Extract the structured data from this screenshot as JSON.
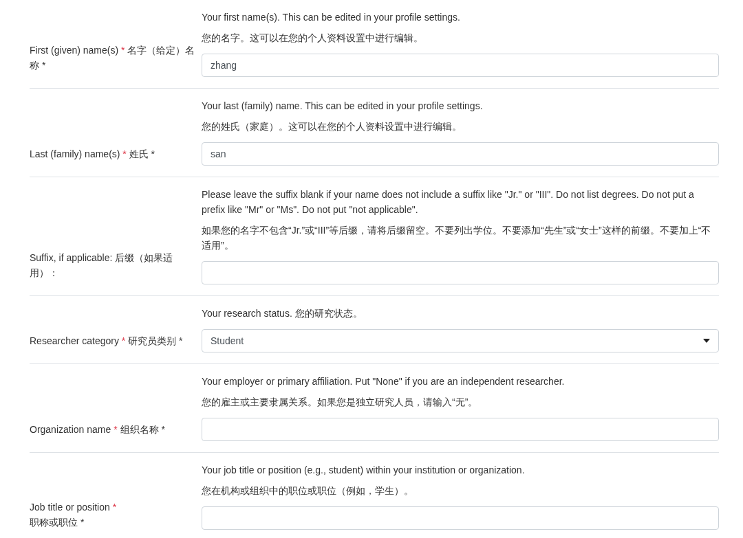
{
  "rows": [
    {
      "label": {
        "kind": "inline",
        "en": "First (given) name(s)",
        "mark": "*",
        "zh": "名字（给定）名称 *"
      },
      "help": [
        "Your first name(s). This can be edited in your profile settings.",
        "您的名字。这可以在您的个人资料设置中进行编辑。"
      ],
      "field": {
        "kind": "text",
        "value": "zhang"
      }
    },
    {
      "label": {
        "kind": "inline",
        "en": "Last (family) name(s)",
        "mark": "*",
        "zh": "姓氏 *"
      },
      "help": [
        "Your last (family) name. This can be edited in your profile settings.",
        "您的姓氏（家庭）。这可以在您的个人资料设置中进行编辑。"
      ],
      "field": {
        "kind": "text",
        "value": "san"
      }
    },
    {
      "label": {
        "kind": "inline",
        "en": "Suffix, if applicable:",
        "zh": "后缀（如果适用）："
      },
      "help": [
        "Please leave the suffix blank if your name does not include a suffix like \"Jr.\" or \"III\". Do not list degrees. Do not put a prefix like \"Mr\" or \"Ms\". Do not put \"not applicable\".",
        "如果您的名字不包含“Jr.”或“III”等后缀，请将后缀留空。不要列出学位。不要添加“先生”或“女士”这样的前缀。不要加上“不适用”。"
      ],
      "field": {
        "kind": "text"
      }
    },
    {
      "label": {
        "kind": "inline",
        "en": "Researcher category",
        "mark": "*",
        "zh": "研究员类别 *"
      },
      "help": [
        "Your research status. 您的研究状态。"
      ],
      "field": {
        "kind": "select",
        "value": "Student"
      }
    },
    {
      "label": {
        "kind": "inline",
        "en": "Organization name",
        "mark": "*",
        "zh": "组织名称 *"
      },
      "help": [
        "Your employer or primary affiliation. Put \"None\" if you are an independent researcher.",
        "您的雇主或主要隶属关系。如果您是独立研究人员，请输入“无”。"
      ],
      "field": {
        "kind": "text"
      }
    },
    {
      "label": {
        "kind": "stacked",
        "en": "Job title or position",
        "mark": "*",
        "zh": "职称或职位 *"
      },
      "help": [
        "Your job title or position (e.g., student) within your institution or organization.",
        "您在机构或组织中的职位或职位（例如，学生）。"
      ],
      "field": {
        "kind": "text"
      }
    }
  ]
}
